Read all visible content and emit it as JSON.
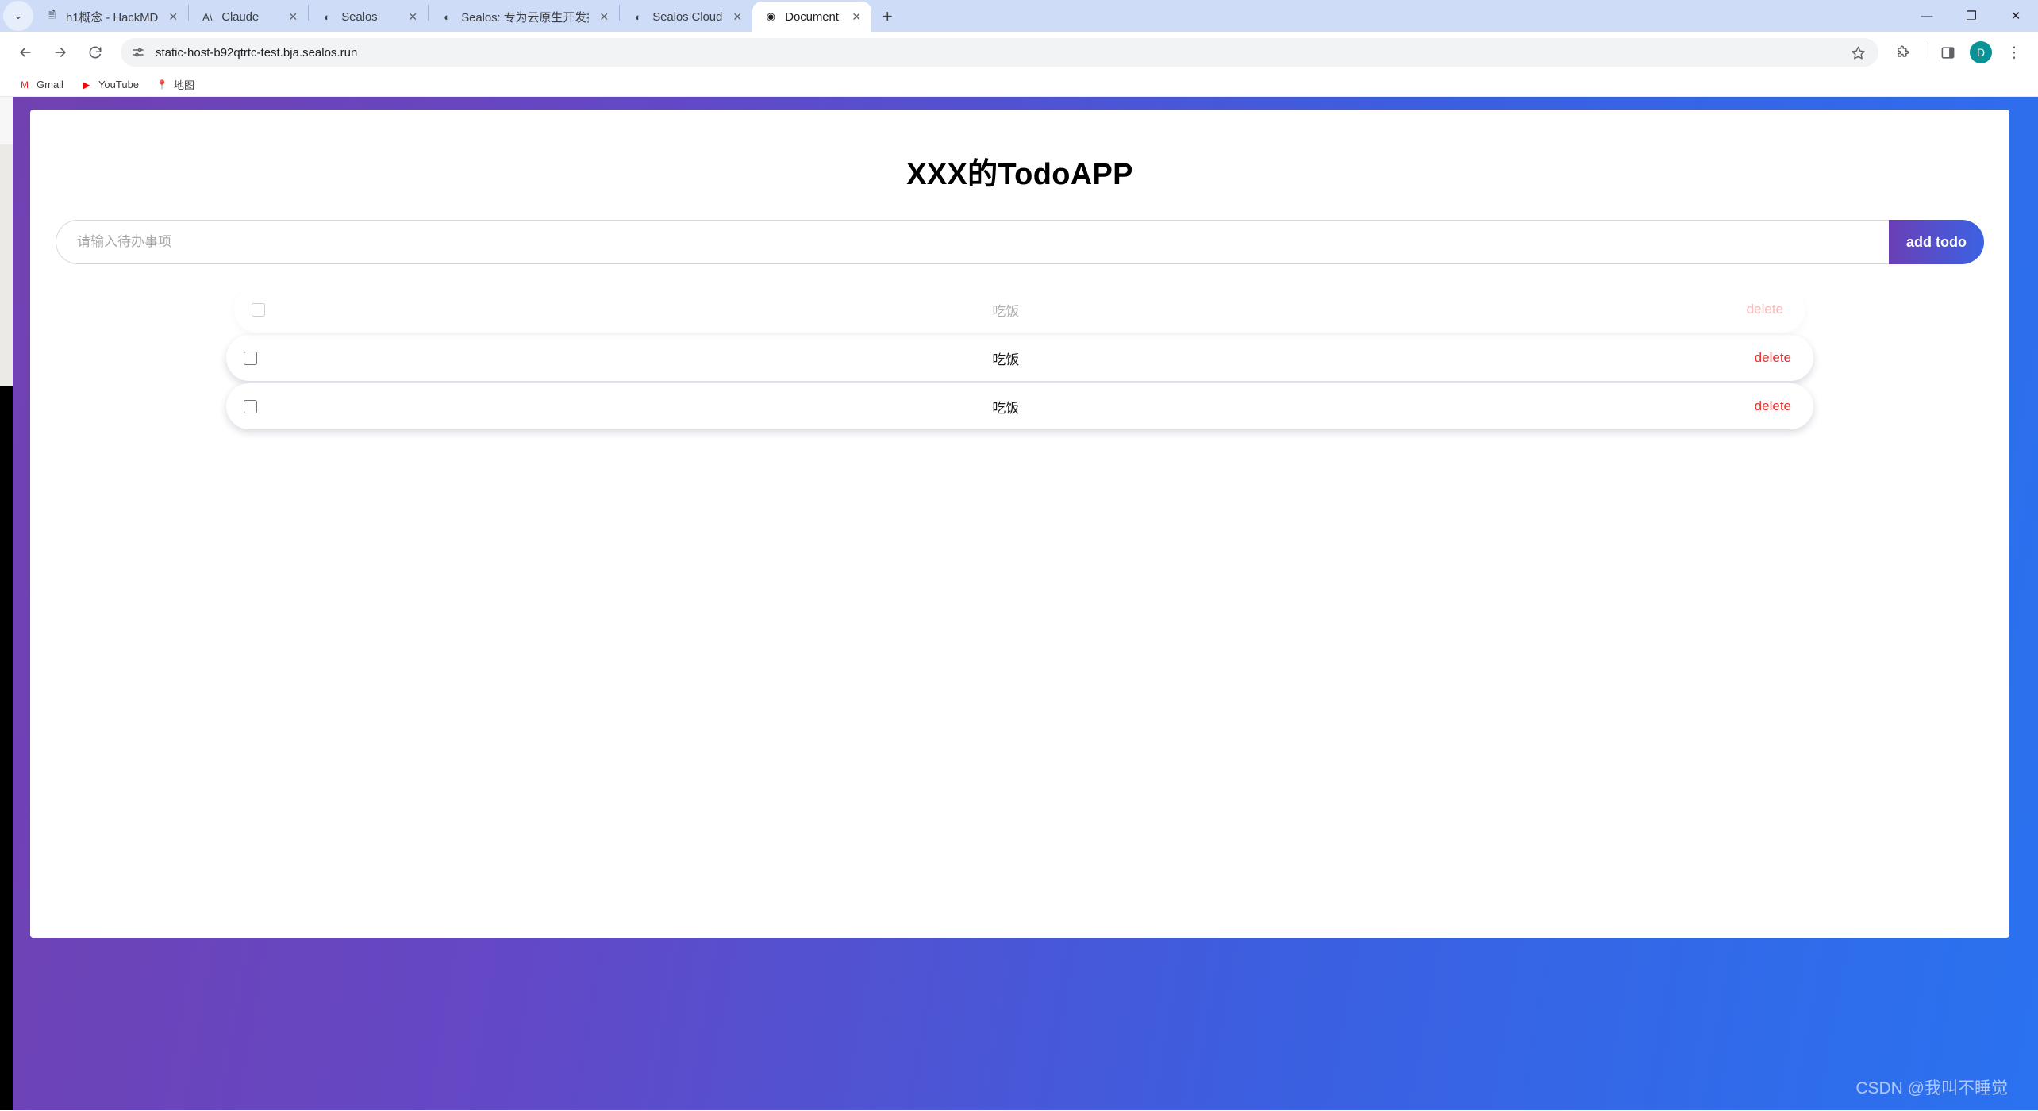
{
  "browser": {
    "tab_list_chevron": "⌄",
    "tabs": [
      {
        "title": "h1概念 - HackMD",
        "favicon": "document-icon",
        "glyph": "🗎",
        "active": false
      },
      {
        "title": "Claude",
        "favicon": "claude-icon",
        "glyph": "A\\",
        "active": false
      },
      {
        "title": "Sealos",
        "favicon": "sealos-icon",
        "glyph": "◐",
        "active": false
      },
      {
        "title": "Sealos: 专为云原生开发打造的",
        "favicon": "sealos-icon",
        "glyph": "◐",
        "active": false
      },
      {
        "title": "Sealos Cloud",
        "favicon": "sealos-icon",
        "glyph": "◐",
        "active": false
      },
      {
        "title": "Document",
        "favicon": "globe-icon",
        "glyph": "◉",
        "active": true
      }
    ],
    "close_glyph": "✕",
    "new_tab_glyph": "+",
    "window_controls": {
      "minimize": "—",
      "maximize": "❐",
      "close": "✕"
    },
    "toolbar": {
      "back_label": "Back",
      "forward_label": "Forward",
      "reload_label": "Reload",
      "site_info_label": "View site information",
      "url": "static-host-b92qtrtc-test.bja.sealos.run",
      "bookmark_label": "Bookmark this tab",
      "extensions_label": "Extensions",
      "side_panel_label": "Side panel",
      "profile_initial": "D",
      "menu_glyph": "⋮"
    },
    "bookmarks": [
      {
        "label": "Gmail",
        "icon": "gmail-icon",
        "glyph": "M"
      },
      {
        "label": "YouTube",
        "icon": "youtube-icon",
        "glyph": "▶"
      },
      {
        "label": "地图",
        "icon": "maps-icon",
        "glyph": "📍"
      }
    ]
  },
  "page": {
    "title": "XXX的TodoAPP",
    "input": {
      "placeholder": "请输入待办事项",
      "value": ""
    },
    "add_button_label": "add todo",
    "todos": [
      {
        "text": "吃饭",
        "delete_label": "delete",
        "checked": false,
        "fading": true
      },
      {
        "text": "吃饭",
        "delete_label": "delete",
        "checked": false,
        "fading": false
      },
      {
        "text": "吃饭",
        "delete_label": "delete",
        "checked": false,
        "fading": false
      }
    ],
    "watermark": "CSDN @我叫不睡觉",
    "colors": {
      "bg_gradient_start": "#7141b1",
      "bg_gradient_end": "#2a72f0",
      "button_gradient_start": "#6b3fb5",
      "button_gradient_end": "#3b62e3",
      "delete_color": "#e8302a"
    }
  }
}
